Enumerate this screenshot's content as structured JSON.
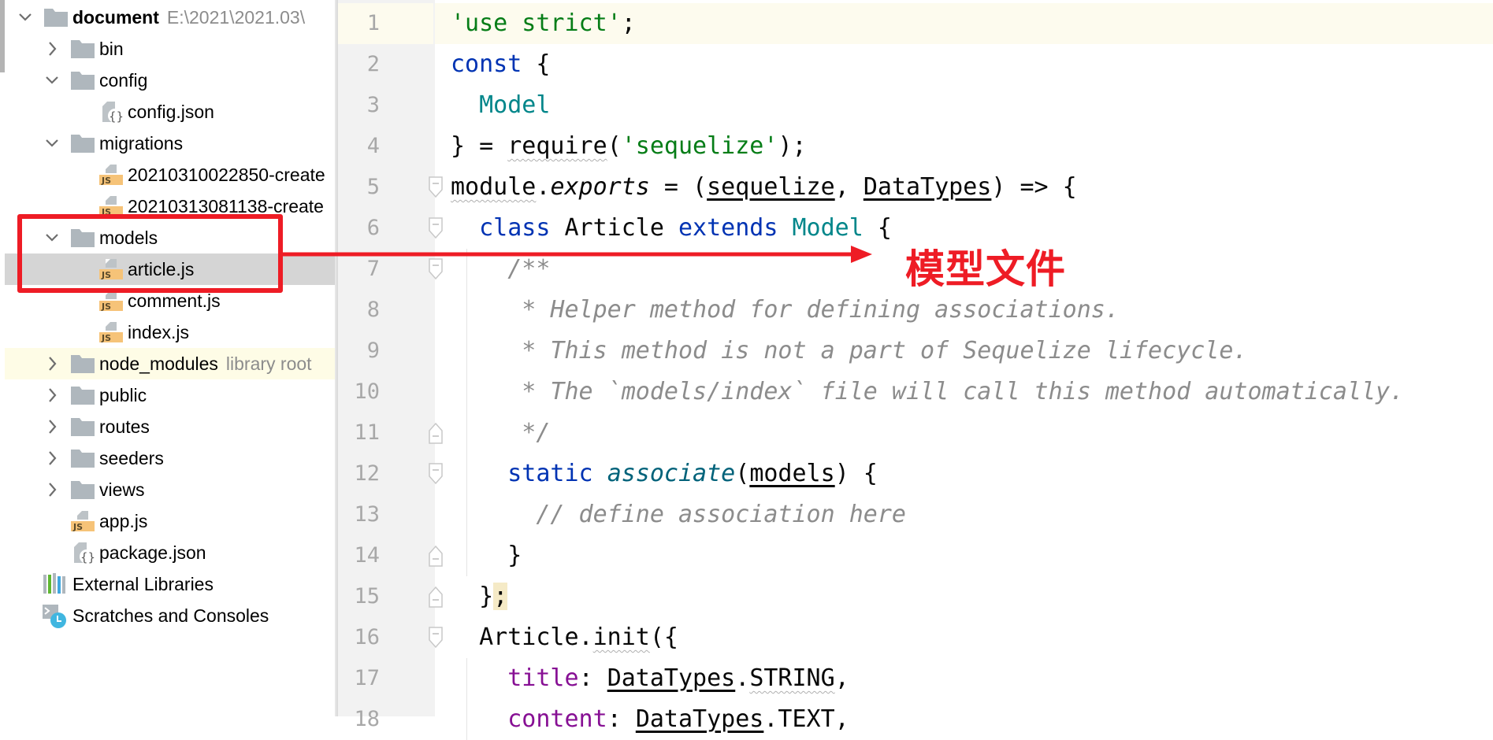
{
  "project_tree": {
    "items": [
      {
        "label": "document",
        "hint": "E:\\2021\\2021.03\\",
        "type": "folder",
        "level": 0,
        "expanded": true,
        "bold": true
      },
      {
        "label": "bin",
        "type": "folder",
        "level": 1,
        "expanded": false
      },
      {
        "label": "config",
        "type": "folder",
        "level": 1,
        "expanded": true
      },
      {
        "label": "config.json",
        "type": "json",
        "level": 2
      },
      {
        "label": "migrations",
        "type": "folder",
        "level": 1,
        "expanded": true
      },
      {
        "label": "20210310022850-create",
        "type": "js",
        "level": 2
      },
      {
        "label": "20210313081138-create",
        "type": "js",
        "level": 2
      },
      {
        "label": "models",
        "type": "folder",
        "level": 1,
        "expanded": true
      },
      {
        "label": "article.js",
        "type": "js",
        "level": 2,
        "selected": true
      },
      {
        "label": "comment.js",
        "type": "js",
        "level": 2
      },
      {
        "label": "index.js",
        "type": "js",
        "level": 2
      },
      {
        "label": "node_modules",
        "hint": "library root",
        "type": "folder",
        "level": 1,
        "expanded": false,
        "library": true
      },
      {
        "label": "public",
        "type": "folder",
        "level": 1,
        "expanded": false
      },
      {
        "label": "routes",
        "type": "folder",
        "level": 1,
        "expanded": false
      },
      {
        "label": "seeders",
        "type": "folder",
        "level": 1,
        "expanded": false
      },
      {
        "label": "views",
        "type": "folder",
        "level": 1,
        "expanded": false
      },
      {
        "label": "app.js",
        "type": "js",
        "level": 1
      },
      {
        "label": "package.json",
        "type": "json",
        "level": 1
      },
      {
        "label": "External Libraries",
        "type": "libraries",
        "level": 0
      },
      {
        "label": "Scratches and Consoles",
        "type": "scratches",
        "level": 0
      }
    ]
  },
  "editor": {
    "current_line": 1,
    "fold_open_lines": [
      5,
      6,
      7,
      12,
      16
    ],
    "fold_close_lines": [
      11,
      14,
      15
    ],
    "lines": [
      [
        [
          "str",
          "'use strict'"
        ],
        [
          "",
          ";"
        ]
      ],
      [
        [
          "kw",
          "const"
        ],
        [
          "",
          " {"
        ]
      ],
      [
        [
          "",
          "  "
        ],
        [
          "cls",
          "Model"
        ]
      ],
      [
        [
          "",
          "} = "
        ],
        [
          "w",
          "require"
        ],
        [
          "",
          "("
        ],
        [
          "str",
          "'sequelize'"
        ],
        [
          "",
          ");"
        ]
      ],
      [
        [
          "w",
          "module"
        ],
        [
          "",
          "."
        ],
        [
          "it",
          "exports"
        ],
        [
          "",
          " = ("
        ],
        [
          "u",
          "sequelize"
        ],
        [
          "",
          ", "
        ],
        [
          "u",
          "DataTypes"
        ],
        [
          "",
          ") => {"
        ]
      ],
      [
        [
          "",
          "  "
        ],
        [
          "kw",
          "class"
        ],
        [
          "",
          " Article "
        ],
        [
          "kw",
          "extends"
        ],
        [
          "",
          " "
        ],
        [
          "cls",
          "Model"
        ],
        [
          "",
          " {"
        ]
      ],
      [
        [
          "",
          "    "
        ],
        [
          "cm",
          "/**"
        ]
      ],
      [
        [
          "cm",
          "     * Helper method for defining associations."
        ]
      ],
      [
        [
          "cm",
          "     * This method is not a part of Sequelize lifecycle."
        ]
      ],
      [
        [
          "cm",
          "     * The `models/index` file will call this method automatically."
        ]
      ],
      [
        [
          "cm",
          "     */"
        ]
      ],
      [
        [
          "",
          "    "
        ],
        [
          "kw",
          "static"
        ],
        [
          "",
          " "
        ],
        [
          "fn",
          "associate"
        ],
        [
          "",
          "("
        ],
        [
          "u",
          "models"
        ],
        [
          "",
          ") {"
        ]
      ],
      [
        [
          "",
          "      "
        ],
        [
          "cm",
          "// define association here"
        ]
      ],
      [
        [
          "",
          "    }"
        ]
      ],
      [
        [
          "",
          "  }"
        ],
        [
          "hl",
          ";"
        ]
      ],
      [
        [
          "",
          "  Article."
        ],
        [
          "w",
          "init"
        ],
        [
          "",
          "({"
        ]
      ],
      [
        [
          "",
          "    "
        ],
        [
          "prop",
          "title"
        ],
        [
          "",
          ": "
        ],
        [
          "u",
          "DataTypes"
        ],
        [
          "",
          "."
        ],
        [
          "w",
          "STRING"
        ],
        [
          "",
          ","
        ]
      ],
      [
        [
          "",
          "    "
        ],
        [
          "prop",
          "content"
        ],
        [
          "",
          ": "
        ],
        [
          "u",
          "DataTypes"
        ],
        [
          "",
          ".TEXT,"
        ]
      ]
    ]
  },
  "annotation": {
    "text": "模型文件",
    "color": "#ee1c25"
  },
  "colors": {
    "keyword": "#0033b3",
    "string": "#067d17",
    "class": "#00868a",
    "comment": "#8c8c8c",
    "property": "#871094",
    "selection": "#d5d5d5"
  }
}
